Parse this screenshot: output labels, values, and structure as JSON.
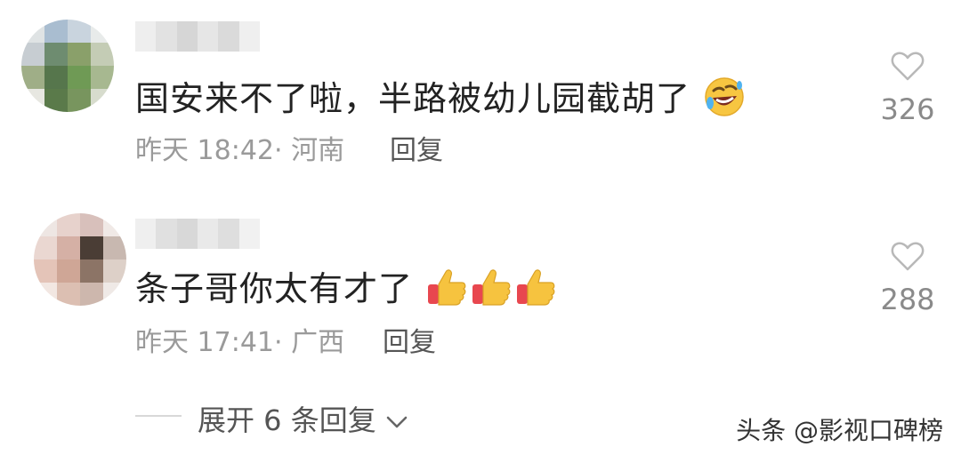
{
  "comments": [
    {
      "text": "国安来不了啦，半路被幼儿园截胡了",
      "meta": "昨天 18:42· 河南",
      "reply_label": "回复",
      "like_count": "326",
      "emoji": "rofl-emoji"
    },
    {
      "text": "条子哥你太有才了",
      "meta": "昨天 17:41· 广西",
      "reply_label": "回复",
      "like_count": "288",
      "emoji": "thumbs-up-emoji"
    }
  ],
  "expand_replies": "展开 6 条回复",
  "watermark": "头条 @影视口碑榜",
  "colors": {
    "text": "#222222",
    "meta": "#9a9a9a",
    "heart_outline": "#b8b8b8",
    "thumb": "#f6c33f",
    "thumb_sleeve": "#e8474f",
    "rofl": "#f7c641"
  },
  "icons": [
    "heart-outline-icon",
    "chevron-down-icon"
  ]
}
